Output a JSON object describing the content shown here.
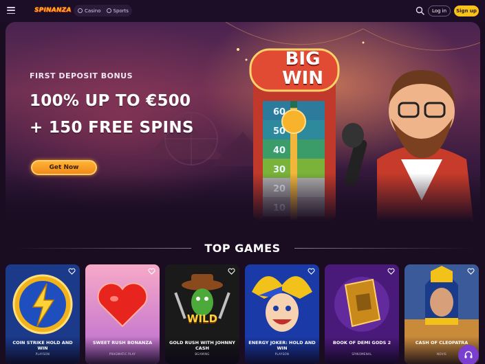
{
  "header": {
    "logo_text": "SPINANZA",
    "modes": [
      {
        "label": "Casino",
        "icon": "casino-icon"
      },
      {
        "label": "Sports",
        "icon": "sports-icon"
      }
    ],
    "login_label": "Log in",
    "signup_label": "Sign up"
  },
  "hero": {
    "eyebrow": "FIRST DEPOSIT BONUS",
    "title_line1": "100% UP TO €500",
    "title_line2": "+ 150 FREE SPINS",
    "cta_label": "Get Now",
    "big_win_line1": "BIG",
    "big_win_line2": "WIN",
    "wheel_numbers": [
      "60",
      "50",
      "40",
      "30",
      "20",
      "10"
    ]
  },
  "section": {
    "title": "TOP GAMES"
  },
  "games": [
    {
      "name": "COIN STRIKE HOLD AND WIN",
      "provider": "PLAYSON"
    },
    {
      "name": "SWEET RUSH BONANZA",
      "provider": "PRAGMATIC PLAY"
    },
    {
      "name": "GOLD RUSH WITH JOHNNY CASH",
      "provider": "BGAMING",
      "art_label": "WILD"
    },
    {
      "name": "ENERGY JOKER: HOLD AND WIN",
      "provider": "PLAYSON"
    },
    {
      "name": "BOOK OF DEMI GODS 2",
      "provider": "SPINOMENAL"
    },
    {
      "name": "CASH OF CLEOPATRA",
      "provider": "NOVIS"
    }
  ],
  "colors": {
    "background": "#1a0d22",
    "accent_yellow": "#f7c21b",
    "cta_orange": "#f08a1b",
    "support_purple": "#7b3fd0"
  }
}
